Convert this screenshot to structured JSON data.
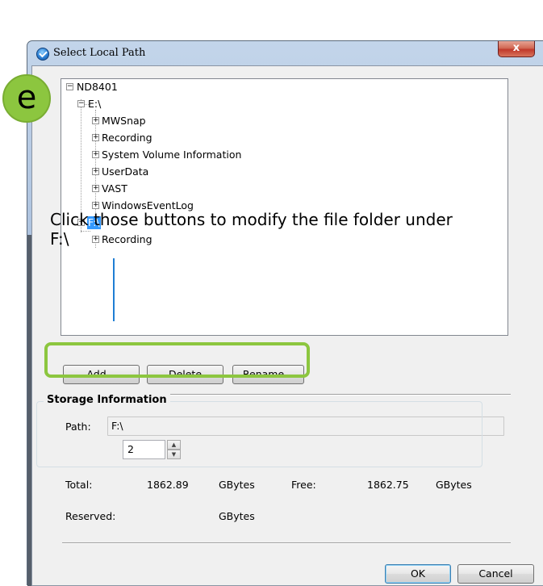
{
  "window": {
    "title": "Select Local Path",
    "close_glyph": "x",
    "title_icon": "vivotek-check-icon"
  },
  "tree": {
    "root": "ND8401",
    "drives": [
      {
        "label": "E:\\",
        "children": [
          "MWSnap",
          "Recording",
          "System Volume Information",
          "UserData",
          "VAST",
          "WindowsEventLog"
        ]
      },
      {
        "label": "F:\\",
        "selected": true,
        "children": [
          "Recording"
        ]
      }
    ],
    "expanded_glyph": "−",
    "collapsed_glyph": "+"
  },
  "annotation": {
    "badge": "e",
    "text": "Click those buttons to modify the file folder under F:\\",
    "accent_color": "#8cc63f",
    "pointer_color": "#1f7ed4"
  },
  "buttons": {
    "add": "Add...",
    "delete": "Delete",
    "rename": "Rename...",
    "ok": "OK",
    "cancel": "Cancel"
  },
  "path": {
    "label": "Path:",
    "value": "F:\\"
  },
  "storage": {
    "title": "Storage Information",
    "total_label": "Total:",
    "total_value": "1862.89",
    "total_unit": "GBytes",
    "free_label": "Free:",
    "free_value": "1862.75",
    "free_unit": "GBytes",
    "reserved_label": "Reserved:",
    "reserved_value": "2",
    "reserved_unit": "GBytes"
  },
  "colors": {
    "selection": "#3399ff",
    "dialog_bg": "#f0f0f0",
    "titlebar": "#aec3df",
    "close": "#c0392b"
  }
}
